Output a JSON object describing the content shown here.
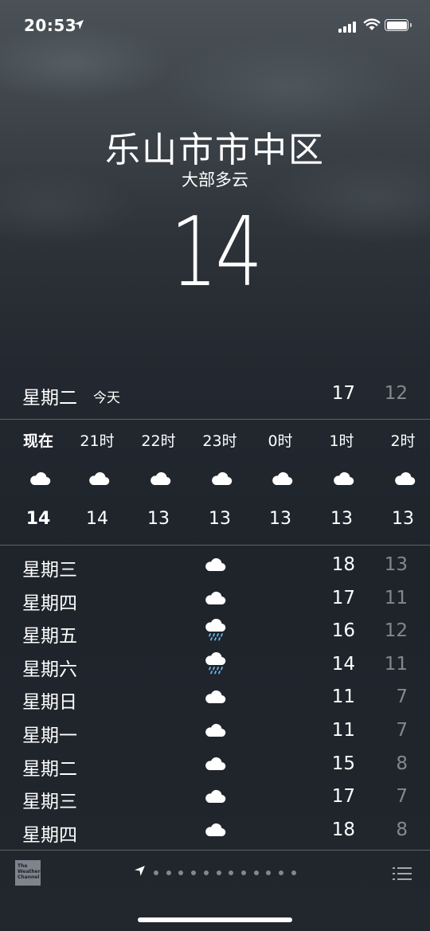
{
  "status_bar": {
    "time": "20:53"
  },
  "header": {
    "city": "乐山市市中区",
    "condition": "大部多云",
    "temperature": "14"
  },
  "today": {
    "day": "星期二",
    "label": "今天",
    "high": "17",
    "low": "12"
  },
  "hourly": [
    {
      "time": "现在",
      "icon": "cloud-icon",
      "temp": "14"
    },
    {
      "time": "21时",
      "icon": "cloud-icon",
      "temp": "14"
    },
    {
      "time": "22时",
      "icon": "cloud-icon",
      "temp": "13"
    },
    {
      "time": "23时",
      "icon": "cloud-icon",
      "temp": "13"
    },
    {
      "time": "0时",
      "icon": "cloud-icon",
      "temp": "13"
    },
    {
      "time": "1时",
      "icon": "cloud-icon",
      "temp": "13"
    },
    {
      "time": "2时",
      "icon": "cloud-icon",
      "temp": "13"
    }
  ],
  "daily": [
    {
      "day": "星期三",
      "icon": "cloud-icon",
      "high": "18",
      "low": "13"
    },
    {
      "day": "星期四",
      "icon": "cloud-icon",
      "high": "17",
      "low": "11"
    },
    {
      "day": "星期五",
      "icon": "rain-icon",
      "high": "16",
      "low": "12"
    },
    {
      "day": "星期六",
      "icon": "rain-icon",
      "high": "14",
      "low": "11"
    },
    {
      "day": "星期日",
      "icon": "cloud-icon",
      "high": "11",
      "low": "7"
    },
    {
      "day": "星期一",
      "icon": "cloud-icon",
      "high": "11",
      "low": "7"
    },
    {
      "day": "星期二",
      "icon": "cloud-icon",
      "high": "15",
      "low": "8"
    },
    {
      "day": "星期三",
      "icon": "cloud-icon",
      "high": "17",
      "low": "7"
    },
    {
      "day": "星期四",
      "icon": "cloud-icon",
      "high": "18",
      "low": "8"
    }
  ],
  "footer": {
    "logo_text": "The Weather Channel",
    "page_count": 12,
    "current_page": "location"
  },
  "colors": {
    "rain_drops": "#5fb8f0",
    "muted_text": "rgba(255,255,255,0.45)"
  }
}
